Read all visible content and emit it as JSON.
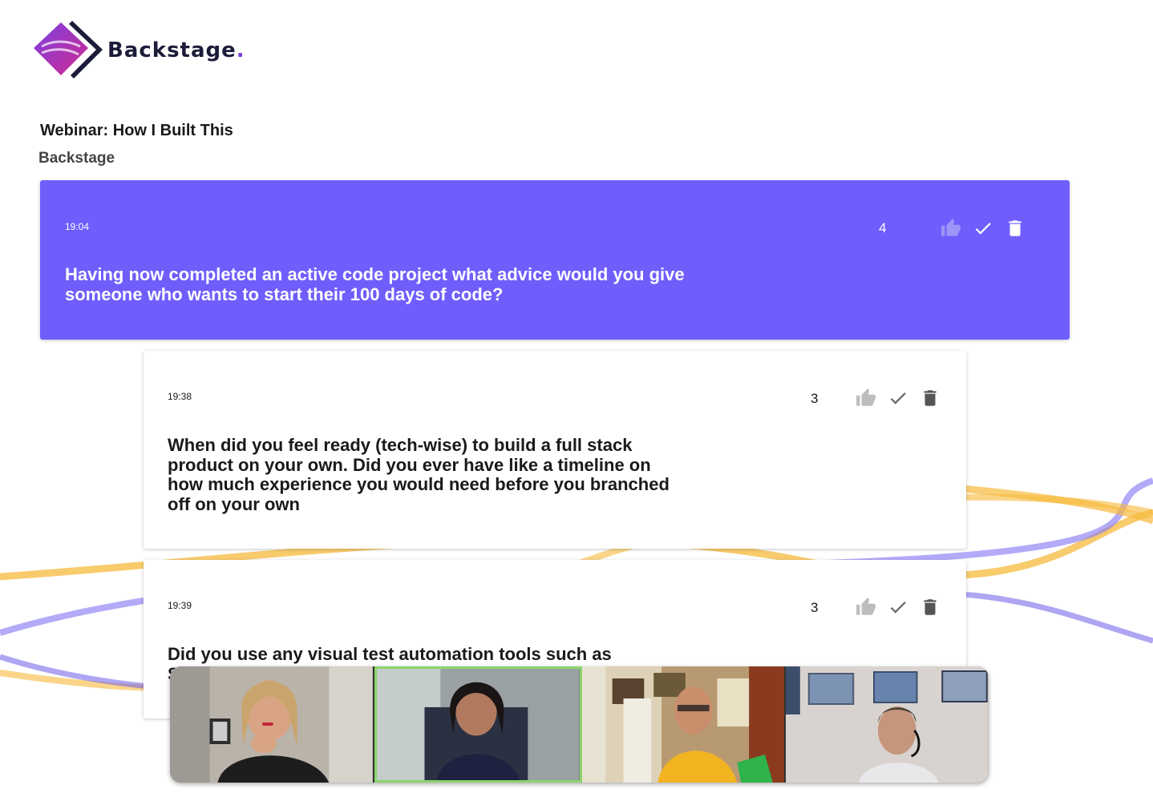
{
  "brand": {
    "name": "Backstage",
    "dot": ".",
    "colors": {
      "primary": "#6f5efc",
      "purple": "#7b3fe4",
      "magenta": "#d12b8e",
      "navy": "#1c1c3a"
    }
  },
  "event": {
    "title": "Webinar: How I Built This",
    "organizer": "Backstage"
  },
  "questions": [
    {
      "time": "19:04",
      "votes": "4",
      "state": "active",
      "lines": [
        "Having now completed an active code project what advice would you give",
        "someone who wants to start their 100 days of code?"
      ]
    },
    {
      "time": "19:38",
      "votes": "3",
      "state": "normal",
      "lines": [
        "When did you feel ready (tech-wise) to build a full stack",
        "product on your own. Did you ever have like a timeline on",
        "how much experience you would need before you branched",
        "off on your own"
      ]
    },
    {
      "time": "19:39",
      "votes": "3",
      "state": "normal",
      "lines": [
        "Did you use any visual test automation tools such as",
        "S"
      ]
    }
  ],
  "icons": {
    "upvote": "thumb-up-icon",
    "answered": "check-icon",
    "delete": "trash-icon"
  },
  "video_participants": [
    {
      "name": "participant-1",
      "speaking": false
    },
    {
      "name": "participant-2",
      "speaking": true
    },
    {
      "name": "participant-3",
      "speaking": false
    },
    {
      "name": "participant-4",
      "speaking": false
    }
  ]
}
